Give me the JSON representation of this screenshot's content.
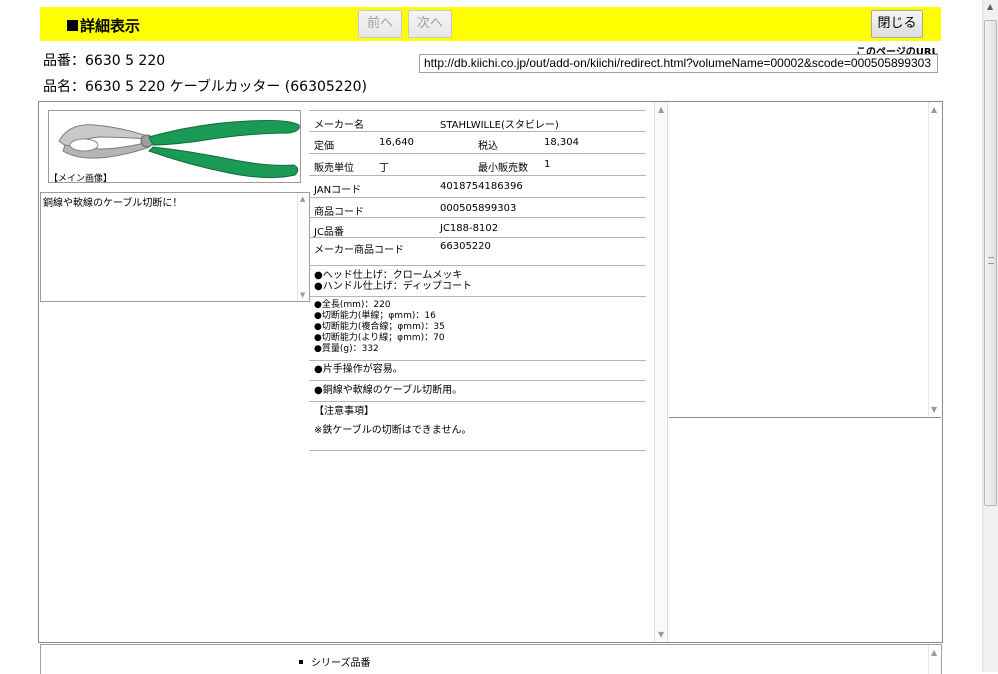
{
  "header": {
    "title": "詳細表示",
    "prev_label": "前へ",
    "next_label": "次へ",
    "close_label": "閉じる"
  },
  "page_url": {
    "label": "このページのURL",
    "value": "http://db.kiichi.co.jp/out/add-on/kiichi/redirect.html?volumeName=00002&scode=000505899303"
  },
  "product": {
    "code_line": "品番：6630 5 220",
    "name_line": "品名：6630 5 220 ケーブルカッター (66305220)"
  },
  "image": {
    "caption": "【メイン画像】"
  },
  "description": "銅線や軟線のケーブル切断に！",
  "spec": {
    "maker_label": "メーカー名",
    "maker_value": "STAHLWILLE(スタビレー)",
    "price_label": "定価",
    "price_value": "16,640",
    "tax_label": "税込",
    "tax_value": "18,304",
    "unit_label": "販売単位",
    "unit_value": "丁",
    "min_label": "最小販売数",
    "min_value": "1",
    "jan_label": "JANコード",
    "jan_value": "4018754186396",
    "product_code_label": "商品コード",
    "product_code_value": "000505899303",
    "jc_label": "JC品番",
    "jc_value": "JC188-8102",
    "maker_code_label": "メーカー商品コード",
    "maker_code_value": "66305220",
    "finish": [
      "●ヘッド仕上げ：クロームメッキ",
      "●ハンドル仕上げ：ディップコート"
    ],
    "dims": [
      "●全長(mm)：220",
      "●切断能力(単線；φmm)：16",
      "●切断能力(複合線；φmm)：35",
      "●切断能力(より線；φmm)：70",
      "●質量(g)：332"
    ],
    "feature1": "●片手操作が容易。",
    "feature2": "●銅線や軟線のケーブル切断用。",
    "note_title": "【注意事項】",
    "note_body": "※鉄ケーブルの切断はできません。"
  },
  "series": {
    "label": "シリーズ品番"
  },
  "colors": {
    "header_bg": "#ffff00",
    "handle_green": "#1a9a55"
  }
}
